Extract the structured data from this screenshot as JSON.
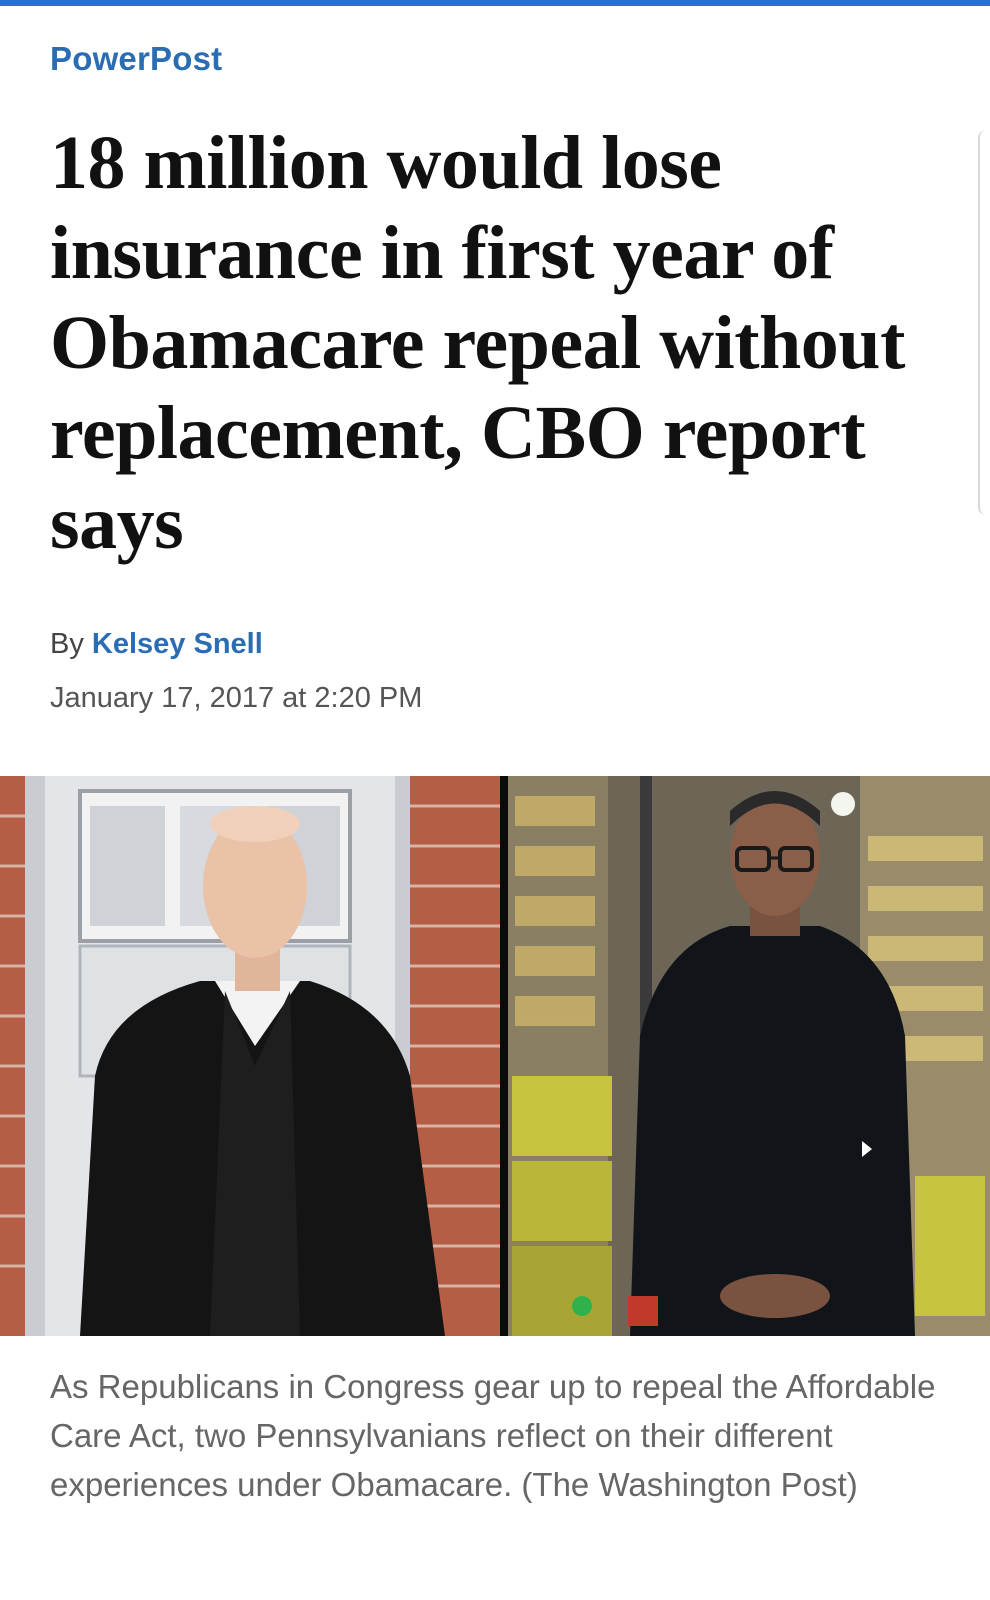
{
  "section": {
    "label": "PowerPost"
  },
  "article": {
    "headline": "18 million would lose insurance in first year of Obamacare repeal without replacement, CBO report says",
    "byline_prefix": "By",
    "author": "Kelsey Snell",
    "date": "January 17, 2017 at 2:20 PM"
  },
  "media": {
    "caption": "As Republicans in Congress gear up to repeal the Affordable Care Act, two Pennsylvanians reflect on their different experiences under Obamacare. (The Washington Post)",
    "play_icon": "play-icon"
  },
  "colors": {
    "accent": "#2f6fce",
    "link": "#2a6db3",
    "headline": "#111111",
    "caption": "#666666"
  }
}
